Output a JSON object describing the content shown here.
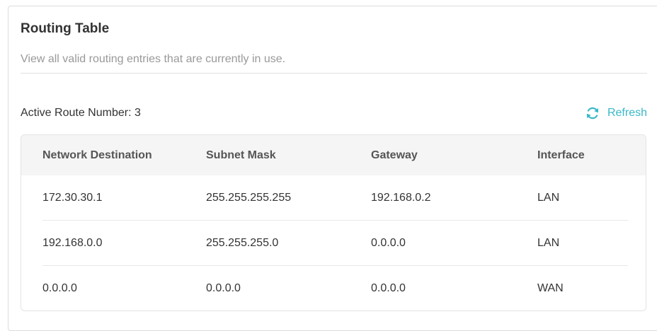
{
  "header": {
    "title": "Routing Table",
    "subtitle": "View all valid routing entries that are currently in use."
  },
  "summary": {
    "active_route_label": "Active Route Number: 3"
  },
  "toolbar": {
    "refresh_label": "Refresh",
    "refresh_icon": "refresh-icon",
    "accent_color": "#39b8c8"
  },
  "table": {
    "columns": [
      "Network Destination",
      "Subnet Mask",
      "Gateway",
      "Interface"
    ],
    "rows": [
      [
        "172.30.30.1",
        "255.255.255.255",
        "192.168.0.2",
        "LAN"
      ],
      [
        "192.168.0.0",
        "255.255.255.0",
        "0.0.0.0",
        "LAN"
      ],
      [
        "0.0.0.0",
        "0.0.0.0",
        "0.0.0.0",
        "WAN"
      ]
    ]
  }
}
